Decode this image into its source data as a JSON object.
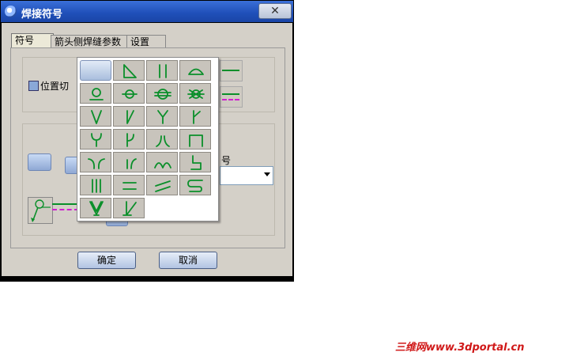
{
  "window": {
    "title": "焊接符号",
    "close_glyph": "✕"
  },
  "tabs": [
    {
      "label": "符号",
      "active": true
    },
    {
      "label": "箭头侧焊缝参数",
      "active": false
    },
    {
      "label": "设置",
      "active": false
    }
  ],
  "options": {
    "position_checkbox_label": "位置切",
    "position_checked": false,
    "partial_label": "号"
  },
  "buttons": {
    "ok": "确定",
    "cancel": "取消"
  },
  "symbol_grid": {
    "columns": 4,
    "items": [
      {
        "name": "blank",
        "icon": "blank"
      },
      {
        "name": "fillet",
        "icon": "fillet-icon"
      },
      {
        "name": "square-groove",
        "icon": "square-groove-icon"
      },
      {
        "name": "arc-top",
        "icon": "arc-icon"
      },
      {
        "name": "plug",
        "icon": "plug-icon"
      },
      {
        "name": "spot",
        "icon": "spot-icon"
      },
      {
        "name": "seam",
        "icon": "seam-icon"
      },
      {
        "name": "stud",
        "icon": "stud-icon"
      },
      {
        "name": "v-groove",
        "icon": "v-groove-icon"
      },
      {
        "name": "bevel-groove",
        "icon": "bevel-groove-icon"
      },
      {
        "name": "y-groove",
        "icon": "y-groove-icon"
      },
      {
        "name": "j-bevel",
        "icon": "j-bevel-icon"
      },
      {
        "name": "u-groove",
        "icon": "u-groove-icon"
      },
      {
        "name": "j-groove",
        "icon": "j-groove-icon"
      },
      {
        "name": "flare-v",
        "icon": "flare-v-icon"
      },
      {
        "name": "flange",
        "icon": "flange-icon"
      },
      {
        "name": "flare-both",
        "icon": "flare-both-icon"
      },
      {
        "name": "flare-bevel",
        "icon": "flare-bevel-icon"
      },
      {
        "name": "surfacing",
        "icon": "surfacing-icon"
      },
      {
        "name": "edge",
        "icon": "edge-icon"
      },
      {
        "name": "triple-line",
        "icon": "triple-line-icon"
      },
      {
        "name": "parallel",
        "icon": "parallel-icon"
      },
      {
        "name": "inclined",
        "icon": "inclined-icon"
      },
      {
        "name": "fold",
        "icon": "fold-icon"
      },
      {
        "name": "double-v-root",
        "icon": "double-v-root-icon"
      },
      {
        "name": "bevel-root",
        "icon": "bevel-root-icon"
      }
    ]
  },
  "colors": {
    "symbol_stroke": "#0a8f2a",
    "dash_magenta": "#d020d0"
  },
  "watermark": "三维网www.3dportal.cn"
}
